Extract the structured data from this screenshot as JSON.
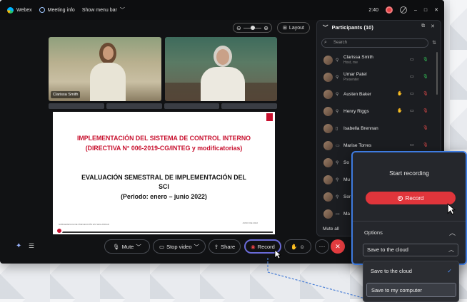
{
  "topbar": {
    "app_name": "Webex",
    "meeting_info": "Meeting info",
    "show_menu_bar": "Show menu bar",
    "time": "2:40",
    "min": "–",
    "max": "□",
    "close": "✕"
  },
  "stage": {
    "layout_label": "Layout",
    "video1_name": "Clarissa Smith"
  },
  "slide": {
    "title_line1": "IMPLEMENTACIÓN DEL SISTEMA DE CONTROL INTERNO",
    "title_line2": "(DIRECTIVA N° 006-2019-CG/INTEG y modificatorias)",
    "sub_line1": "EVALUACIÓN SEMESTRAL DE IMPLEMENTACIÓN DEL",
    "sub_line2": "SCI",
    "period": "(Periodo: enero – junio 2022)",
    "foot_left": "SUBGERENCIA DE PREVENCIÓN EN SEGURIDAD",
    "foot_right": "JUNIO DE 2022"
  },
  "controls": {
    "mute": "Mute",
    "stop_video": "Stop video",
    "share": "Share",
    "record": "Record"
  },
  "participants": {
    "header": "Participants (10)",
    "search_placeholder": "Search",
    "mute_all": "Mute all",
    "people": [
      {
        "name": "Clarissa Smith",
        "role": "Host, me"
      },
      {
        "name": "Umar Patel",
        "role": "Presenter"
      },
      {
        "name": "Austen Baker",
        "role": ""
      },
      {
        "name": "Henry Riggs",
        "role": ""
      },
      {
        "name": "Isabella Brennan",
        "role": ""
      },
      {
        "name": "Marise Torres",
        "role": ""
      },
      {
        "name": "So",
        "role": ""
      },
      {
        "name": "Mu",
        "role": ""
      },
      {
        "name": "Sor",
        "role": ""
      },
      {
        "name": "Ma",
        "role": ""
      }
    ]
  },
  "recording_popup": {
    "title": "Start recording",
    "record_button": "Record",
    "options_label": "Options",
    "selected_option": "Save to the cloud"
  },
  "dropdown": {
    "options": [
      "Save to the cloud",
      "Save to my computer"
    ]
  },
  "colors": {
    "record_red": "#e0353b",
    "accent_blue": "#3e7be0",
    "slide_red": "#c8102e"
  }
}
